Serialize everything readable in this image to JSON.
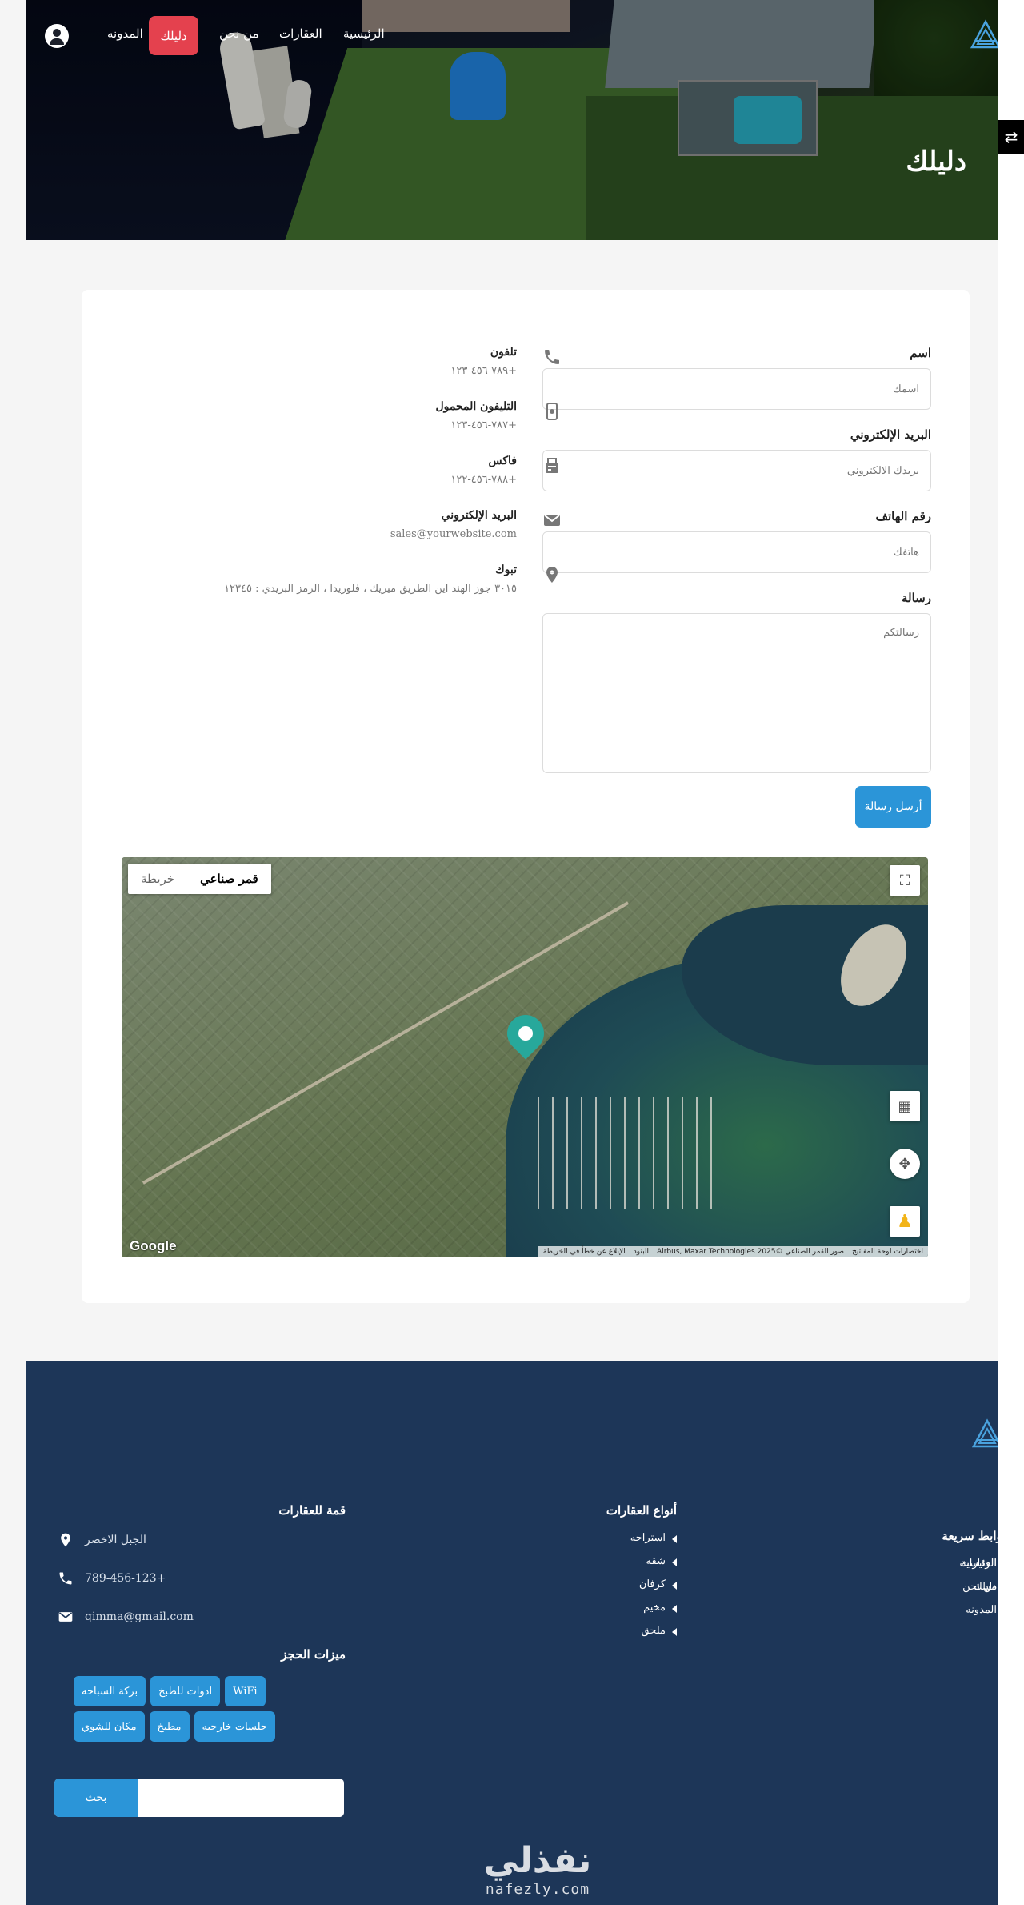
{
  "nav": {
    "items": [
      "الرئيسية",
      "العقارات",
      "من نحن",
      "المدونه"
    ],
    "active": "دليلك"
  },
  "hero": {
    "title": "دليلك"
  },
  "form": {
    "name_label": "اسم",
    "name_placeholder": "اسمك",
    "email_label": "البريد الإلكتروني",
    "email_placeholder": "بريدك الالكتروني",
    "phone_label": "رقم الهاتف",
    "phone_placeholder": "هاتفك",
    "message_label": "رسالة",
    "message_placeholder": "رسالتكم",
    "submit_label": "أرسل رسالة"
  },
  "contact_info": {
    "phone_title": "تلفون",
    "phone_value": "+٧٨٩-٤٥٦-١٢٣",
    "mobile_title": "التليفون المحمول",
    "mobile_value": "+٧٨٧-٤٥٦-١٢٣",
    "fax_title": "فاكس",
    "fax_value": "+٧٨٨-٤٥٦-١٢٢",
    "email_title": "البريد الإلكتروني",
    "email_value": "sales@yourwebsite.com",
    "address_title": "تبوك",
    "address_value": "٣٠١٥ جوز الهند اين الطريق ميريك ، فلوريدا ، الرمز البريدي : ١٢٣٤٥"
  },
  "map": {
    "type_satellite": "قمر صناعي",
    "type_map": "خريطة",
    "google": "Google",
    "attribution": [
      "اختصارات لوحة المفاتيح",
      "صور القمر الصناعي ©2025 Airbus, Maxar Technologies",
      "البنود",
      "الإبلاغ عن خطأ في الخريطة"
    ]
  },
  "footer": {
    "quick_links_title": "روابط سريعة",
    "quick_links_col1": [
      "الرئيسية",
      "من نحن",
      "المدونه"
    ],
    "quick_links_col2": [
      "العقارات",
      "دليلك"
    ],
    "types_title": "أنواع العقارات",
    "types": [
      "استراحه",
      "شقه",
      "كرفان",
      "مخيم",
      "ملحق"
    ],
    "brand_title": "قمة للعقارات",
    "location": "الجبل الاخضر",
    "phone": "+789-456-123",
    "email": "qimma@gmail.com",
    "features_title": "ميزات الحجز",
    "features": [
      "WiFi",
      "ادوات للطبخ",
      "بركة السباحه",
      "جلسات خارجيه",
      "مطبخ",
      "مكان للشوي"
    ],
    "search_button": "بحث",
    "search_placeholder": ""
  },
  "watermark": {
    "ar": "نفذلي",
    "en": "nafezly.com"
  },
  "colors": {
    "accent": "#2b95d8",
    "active_nav": "#e4414e",
    "footer_bg": "#1d3658",
    "pin": "#27a89b"
  }
}
